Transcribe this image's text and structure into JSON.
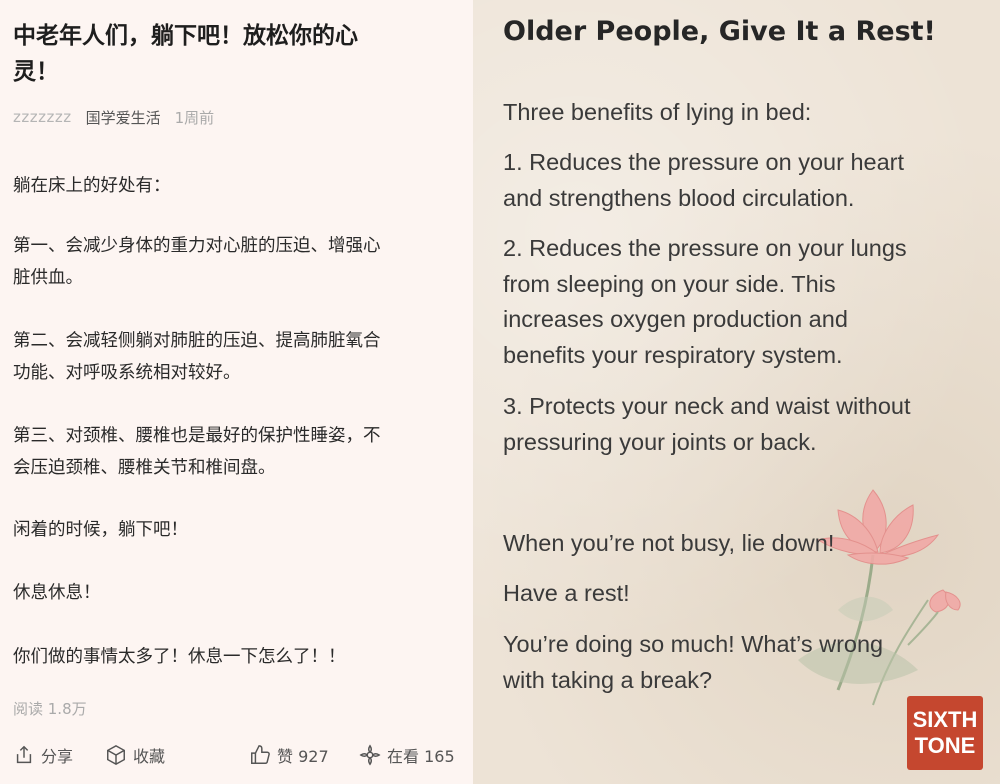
{
  "article": {
    "title_line1": "中老年人们，躺下吧！放松你的心",
    "title_line2": "灵！",
    "author": "zzzzzzz",
    "account": "国学爱生活",
    "time": "1周前",
    "paragraphs": [
      [
        "躺在床上的好处有："
      ],
      [
        "第一、会减少身体的重力对心脏的压迫、增强心",
        "脏供血。"
      ],
      [
        "第二、会减轻侧躺对肺脏的压迫、提高肺脏氧合",
        "功能、对呼吸系统相对较好。"
      ],
      [
        "第三、对颈椎、腰椎也是最好的保护性睡姿，不",
        "会压迫颈椎、腰椎关节和椎间盘。"
      ],
      [
        "闲着的时候，躺下吧！"
      ],
      [
        "休息休息！"
      ],
      [
        "你们做的事情太多了！休息一下怎么了！！"
      ]
    ],
    "reads": "阅读 1.8万",
    "actions": {
      "share": "分享",
      "favorite": "收藏",
      "like": "赞 927",
      "watching": "在看 165"
    }
  },
  "poster": {
    "title": "Older People, Give It a Rest!",
    "intro": "Three benefits of lying in bed:",
    "benefits": [
      [
        "1. Reduces the pressure on your heart",
        "and strengthens blood circulation."
      ],
      [
        "2. Reduces the pressure on your lungs",
        "from sleeping on your side. This",
        "increases oxygen production and",
        "benefits your respiratory system."
      ],
      [
        "3. Protects your neck and waist without",
        "pressuring your joints or back."
      ]
    ],
    "closing": [
      "When you’re not busy, lie down!",
      "Have a rest!",
      "You’re doing so much! What’s wrong",
      "with taking a break?"
    ],
    "logo": [
      "SIXTH",
      "TONE"
    ],
    "logo_color": "#c5472f"
  }
}
